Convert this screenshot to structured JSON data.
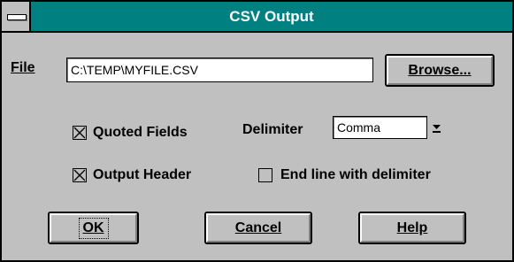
{
  "window": {
    "title": "CSV Output"
  },
  "file": {
    "label": "File",
    "value": "C:\\TEMP\\MYFILE.CSV"
  },
  "buttons": {
    "browse": "Browse...",
    "ok": "OK",
    "cancel": "Cancel",
    "help": "Help"
  },
  "options": {
    "quoted_fields": {
      "label": "Quoted Fields",
      "checked": true
    },
    "output_header": {
      "label": "Output Header",
      "checked": true
    },
    "end_line_with_delimiter": {
      "label": "End line with delimiter",
      "checked": false
    }
  },
  "delimiter": {
    "label": "Delimiter",
    "value": "Comma"
  },
  "icons": {
    "system_menu": "system-menu-icon",
    "dropdown": "dropdown-arrow-icon",
    "checkmark": "x-check-icon"
  }
}
